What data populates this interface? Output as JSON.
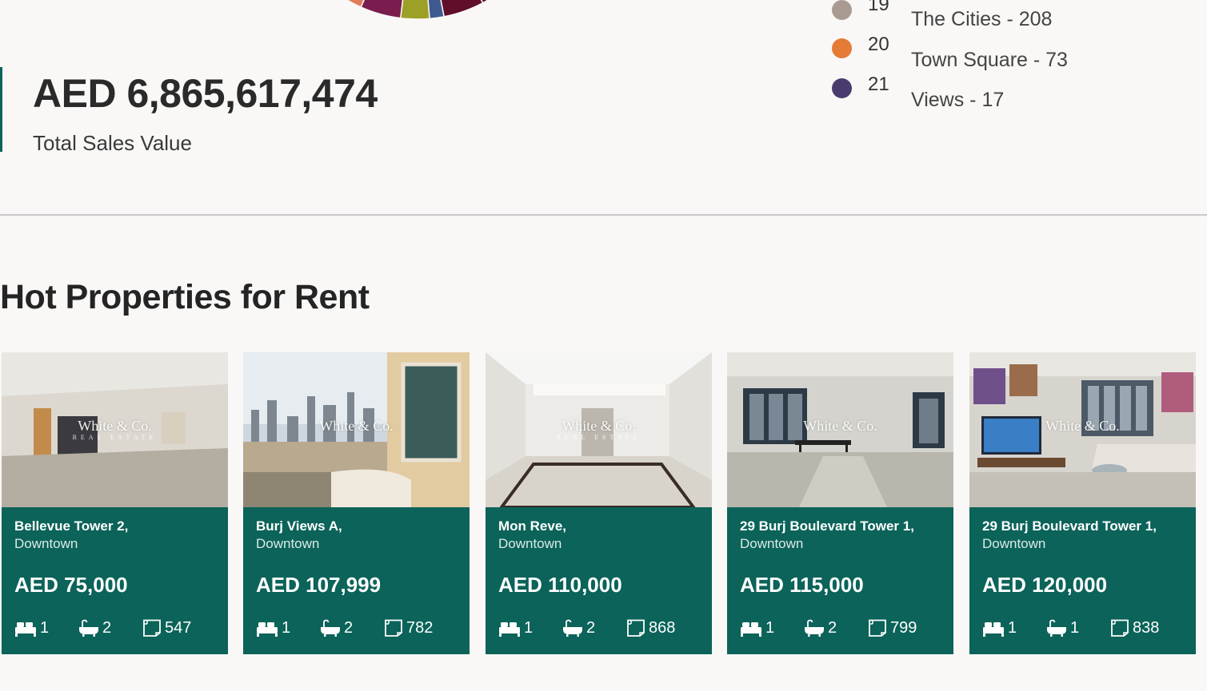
{
  "stats": {
    "total_value": "AED 6,865,617,474",
    "total_label": "Total Sales Value"
  },
  "donut": {
    "colors": [
      "#e0866c",
      "#e27d5a",
      "#7a1d4e",
      "#9da027",
      "#3e5a8e",
      "#5f0f2a",
      "#5a1830",
      "#2f6e63"
    ]
  },
  "legend": {
    "items": [
      {
        "index": "19",
        "label": "The Cities - 208",
        "color": "#a99b91"
      },
      {
        "index": "20",
        "label": "Town Square - 73",
        "color": "#e47b37"
      },
      {
        "index": "21",
        "label": "Views - 17",
        "color": "#4a3b6e"
      }
    ]
  },
  "hot_rent": {
    "title": "Hot Properties for Rent",
    "watermark": "White & Co.",
    "watermark_sub": "REAL ESTATE",
    "cards": [
      {
        "name": "Bellevue Tower 2,",
        "area": "Downtown",
        "price": "AED 75,000",
        "beds": "1",
        "baths": "2",
        "size": "547",
        "photo": "empty-room"
      },
      {
        "name": "Burj Views A,",
        "area": "Downtown",
        "price": "AED 107,999",
        "beds": "1",
        "baths": "2",
        "size": "782",
        "photo": "city-view"
      },
      {
        "name": "Mon Reve,",
        "area": "Downtown",
        "price": "AED 110,000",
        "beds": "1",
        "baths": "2",
        "size": "868",
        "photo": "bright-room"
      },
      {
        "name": "29 Burj Boulevard Tower 1,",
        "area": "Downtown",
        "price": "AED 115,000",
        "beds": "1",
        "baths": "2",
        "size": "799",
        "photo": "dining-room"
      },
      {
        "name": "29 Burj Boulevard Tower 1,",
        "area": "Downtown",
        "price": "AED 120,000",
        "beds": "1",
        "baths": "1",
        "size": "838",
        "photo": "living-room"
      }
    ]
  }
}
